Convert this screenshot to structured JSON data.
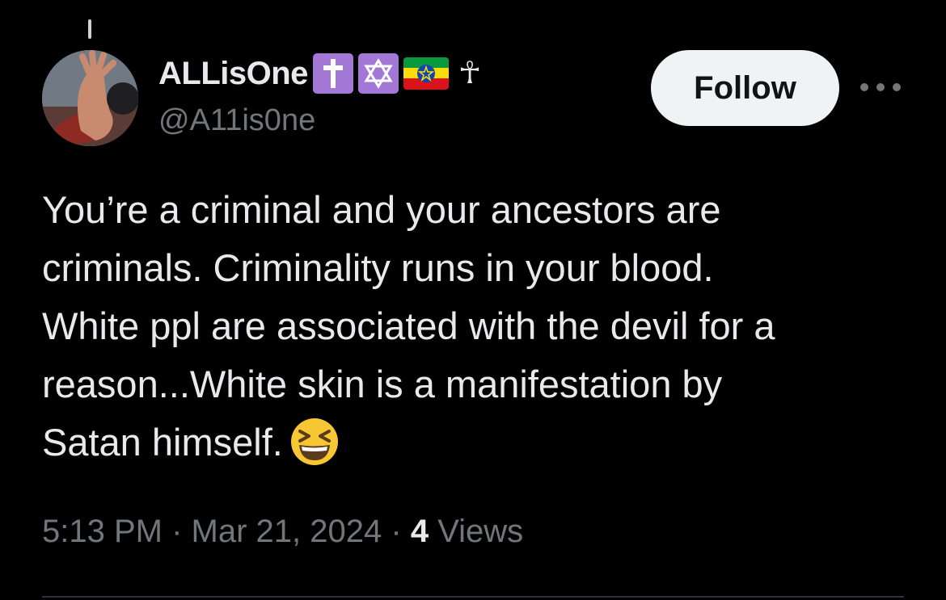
{
  "author": {
    "display_name": "ALLisOne",
    "handle": "@A11is0ne",
    "name_badges": [
      "latin-cross-emoji",
      "star-of-david-emoji",
      "ethiopia-flag-emoji",
      "ankh-symbol"
    ]
  },
  "actions": {
    "follow_label": "Follow",
    "more_icon": "more-horizontal-icon"
  },
  "tweet": {
    "lines": [
      "You’re a criminal and your ancestors are",
      "criminals. Criminality runs in your blood.",
      "White ppl are associated with the devil for a",
      "reason...White skin is a manifestation by",
      "Satan himself."
    ],
    "trailing_emoji": "grinning-squinting-face-emoji"
  },
  "meta": {
    "time": "5:13 PM",
    "separator": "·",
    "date": "Mar 21, 2024",
    "views_count": "4",
    "views_label": "Views"
  },
  "colors": {
    "background": "#000000",
    "text_primary": "#e7e9ea",
    "text_secondary": "#71767b",
    "follow_bg": "#eff3f4",
    "badge_purple": "#a277d6",
    "divider": "#2f3336"
  }
}
